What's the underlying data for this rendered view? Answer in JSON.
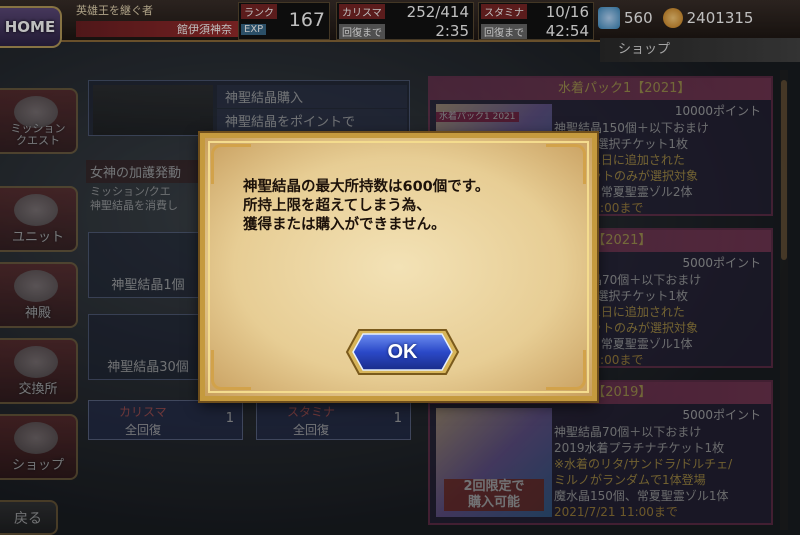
{
  "header": {
    "home_label": "HOME",
    "player_title": "英雄王を継ぐ者",
    "player_name": "館伊須神奈",
    "rank_label": "ランク",
    "exp_label": "EXP",
    "rank_value": "167",
    "charisma_label": "カリスマ",
    "charisma_value": "252/414",
    "charisma_recover_label": "回復まで",
    "charisma_recover_time": "2:35",
    "stamina_label": "スタミナ",
    "stamina_value": "10/16",
    "stamina_recover_label": "回復まで",
    "stamina_recover_time": "42:54",
    "crystals": "560",
    "gold": "2401315",
    "shop_tab": "ショップ"
  },
  "nav": [
    {
      "label": "ミッション\nクエスト"
    },
    {
      "label": "ユニット"
    },
    {
      "label": "神殿"
    },
    {
      "label": "交換所"
    },
    {
      "label": "ショップ"
    }
  ],
  "back_label": "戻る",
  "middle": {
    "purchase_title": "神聖結晶購入",
    "points_title": "神聖結晶をポイントで",
    "blessing_title": "女神の加護発動",
    "blessing_text": "ミッション/クエ\n神聖結晶を消費し",
    "crystal_1": "神聖結晶1個",
    "crystal_30": "神聖結晶30個",
    "recover_charisma_name": "カリスマ",
    "recover_charisma_action": "全回復",
    "recover_charisma_cost": "1",
    "recover_stamina_name": "スタミナ",
    "recover_stamina_action": "全回復",
    "recover_stamina_cost": "1"
  },
  "packs": [
    {
      "title": "水着パック1【2021】",
      "image_label": "水着パック1 2021",
      "points": "10000ポイント",
      "lines": [
        "神聖結晶150個＋以下おまけ",
        "★6水着選択チケット1枚",
        "1年7月1日に追加された",
        "着ユニットのみが選択対象",
        "300個、常夏聖霊ゾル2体"
      ],
      "date": "7/21 11:00まで"
    },
    {
      "title": "ック2【2021】",
      "points": "5000ポイント",
      "lines": [
        "神聖結晶70個＋以下おまけ",
        "★5水着選択チケット1枚",
        "1年7月1日に追加された",
        "着ユニットのみが選択対象",
        "150個、常夏聖霊ゾル1体"
      ],
      "date": "7/21 11:00まで"
    },
    {
      "title": "ック2【2019】",
      "points": "5000ポイント",
      "image_label": "2回限定で\n購入可能",
      "lines": [
        "神聖結晶70個＋以下おまけ",
        "2019水着プラチナチケット1枚",
        "※水着のリタ/サンドラ/ドルチェ/",
        "ミルノがランダムで1体登場",
        "魔水晶150個、常夏聖霊ゾル1体"
      ],
      "date": "2021/7/21 11:00まで"
    }
  ],
  "dialog": {
    "message": "神聖結晶の最大所持数は600個です。\n所持上限を超えてしまう為、\n獲得または購入ができません。",
    "ok_label": "OK"
  }
}
